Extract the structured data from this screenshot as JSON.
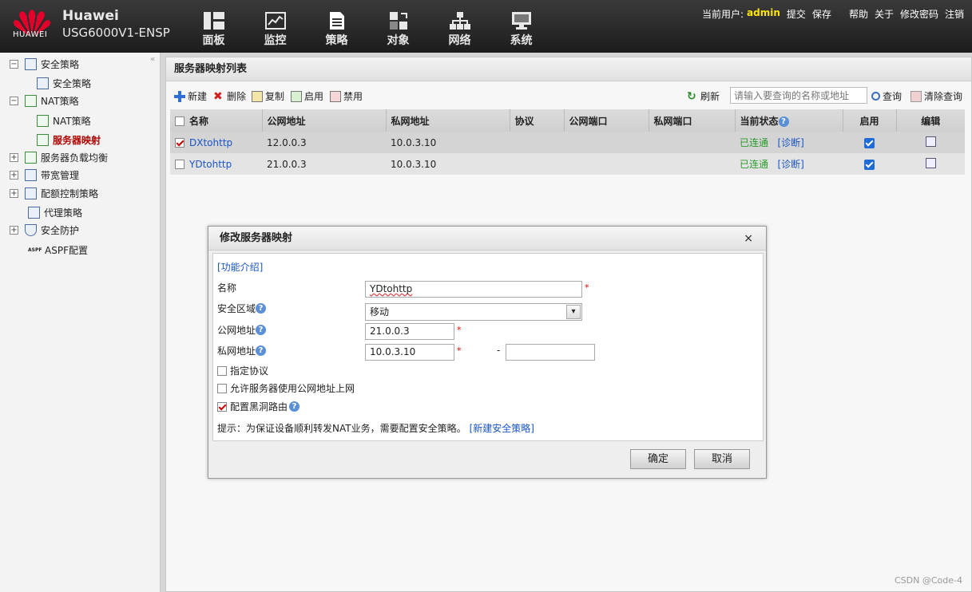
{
  "header": {
    "brand": "Huawei",
    "model": "USG6000V1-ENSP",
    "logo_text": "HUAWEI",
    "nav": [
      {
        "label": "面板",
        "icon": "dashboard-icon"
      },
      {
        "label": "监控",
        "icon": "monitor-chart-icon"
      },
      {
        "label": "策略",
        "icon": "policy-document-icon"
      },
      {
        "label": "对象",
        "icon": "object-icon"
      },
      {
        "label": "网络",
        "icon": "network-icon"
      },
      {
        "label": "系统",
        "icon": "system-monitor-icon"
      }
    ],
    "current_user_label": "当前用户:",
    "current_user": "admin",
    "actions": [
      "提交",
      "保存",
      "帮助",
      "关于",
      "修改密码",
      "注销"
    ]
  },
  "sidebar": {
    "items": [
      {
        "label": "安全策略",
        "expander": "−"
      },
      {
        "label": "安全策略"
      },
      {
        "label": "NAT策略",
        "expander": "−"
      },
      {
        "label": "NAT策略"
      },
      {
        "label": "服务器映射"
      },
      {
        "label": "服务器负载均衡",
        "expander": "+"
      },
      {
        "label": "带宽管理",
        "expander": "+"
      },
      {
        "label": "配额控制策略",
        "expander": "+"
      },
      {
        "label": "代理策略"
      },
      {
        "label": "安全防护",
        "expander": "+"
      },
      {
        "label": "ASPF配置",
        "icon_text": "ASPF"
      }
    ]
  },
  "main": {
    "title": "服务器映射列表",
    "toolbar": {
      "new": "新建",
      "delete": "删除",
      "copy": "复制",
      "enable": "启用",
      "disable": "禁用",
      "refresh": "刷新",
      "search_placeholder": "请输入要查询的名称或地址",
      "query": "查询",
      "clear_query": "清除查询"
    },
    "columns": [
      "名称",
      "公网地址",
      "私网地址",
      "协议",
      "公网端口",
      "私网端口",
      "当前状态",
      "启用",
      "编辑"
    ],
    "rows": [
      {
        "name": "DXtohttp",
        "public": "12.0.0.3",
        "private": "10.0.3.10",
        "protocol": "",
        "public_port": "",
        "private_port": "",
        "status": "已连通",
        "diagnose": "[诊断]",
        "selected": true,
        "enabled": true
      },
      {
        "name": "YDtohttp",
        "public": "21.0.0.3",
        "private": "10.0.3.10",
        "protocol": "",
        "public_port": "",
        "private_port": "",
        "status": "已连通",
        "diagnose": "[诊断]",
        "selected": false,
        "enabled": true
      }
    ]
  },
  "dialog": {
    "title": "修改服务器映射",
    "close": "×",
    "intro_link": "[功能介绍]",
    "name_label": "名称",
    "name_value": "YDtohttp",
    "zone_label": "安全区域",
    "zone_value": "移动",
    "public_label": "公网地址",
    "public_value": "21.0.0.3",
    "private_label": "私网地址",
    "private_value": "10.0.3.10",
    "private_range_value": "",
    "range_sep": "-",
    "required_mark": "*",
    "help_mark": "?",
    "opt_protocol": "指定协议",
    "opt_protocol_checked": false,
    "opt_allow_internet": "允许服务器使用公网地址上网",
    "opt_allow_internet_checked": false,
    "opt_blackhole": "配置黑洞路由",
    "opt_blackhole_checked": true,
    "hint": "提示：为保证设备顺利转发NAT业务，需要配置安全策略。",
    "hint_link": "[新建安全策略]",
    "ok": "确定",
    "cancel": "取消"
  },
  "watermark": "CSDN @Code-4",
  "colors": {
    "accent_link": "#1a55c8",
    "active_tree": "#b00000",
    "status_ok": "#2a9a2a",
    "user_highlight": "#ffe600"
  }
}
